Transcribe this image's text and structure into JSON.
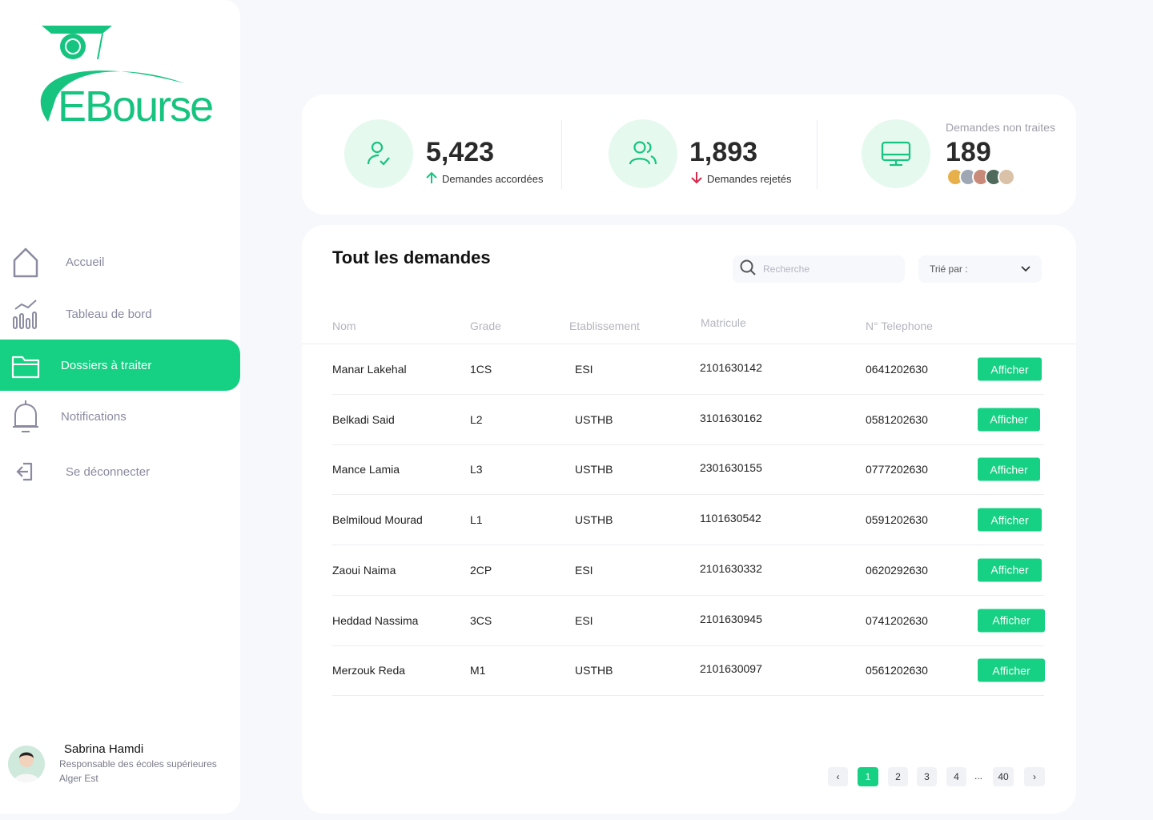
{
  "brand": {
    "name": "EBourse",
    "color": "#16d083"
  },
  "nav": [
    {
      "label": "Accueil",
      "icon": "home-icon"
    },
    {
      "label": "Tableau de bord",
      "icon": "chart-icon"
    },
    {
      "label": "Dossiers à traiter",
      "icon": "folder-icon",
      "active": true
    },
    {
      "label": "Notifications",
      "icon": "bell-icon"
    },
    {
      "label": "Se déconnecter",
      "icon": "logout-icon"
    }
  ],
  "profile": {
    "name": "Sabrina Hamdi",
    "role": "Responsable des écoles supérieures",
    "location": "Alger Est"
  },
  "stats": {
    "accepted": {
      "value": "5,423",
      "label": "Demandes accordées",
      "trend": "up"
    },
    "rejected": {
      "value": "1,893",
      "label": "Demandes rejetés",
      "trend": "down"
    },
    "pending": {
      "caption": "Demandes non traites",
      "value": "189"
    }
  },
  "table": {
    "title": "Tout les demandes",
    "search_placeholder": "Recherche",
    "sort_label": "Trié par :",
    "columns": [
      "Nom",
      "Grade",
      "Etablissement",
      "Matricule",
      "N° Telephone"
    ],
    "action_label": "Afficher",
    "rows": [
      {
        "nom": "Manar Lakehal",
        "grade": "1CS",
        "etab": "ESI",
        "matricule": "2101630142",
        "tel": "0641202630"
      },
      {
        "nom": "Belkadi Said",
        "grade": "L2",
        "etab": "USTHB",
        "matricule": "3101630162",
        "tel": "0581202630"
      },
      {
        "nom": "Mance Lamia",
        "grade": "L3",
        "etab": "USTHB",
        "matricule": "2301630155",
        "tel": "0777202630"
      },
      {
        "nom": "Belmiloud Mourad",
        "grade": "L1",
        "etab": "USTHB",
        "matricule": "1101630542",
        "tel": "0591202630"
      },
      {
        "nom": "Zaoui Naima",
        "grade": "2CP",
        "etab": "ESI",
        "matricule": "2101630332",
        "tel": "0620292630"
      },
      {
        "nom": "Heddad Nassima",
        "grade": "3CS",
        "etab": "ESI",
        "matricule": "2101630945",
        "tel": "0741202630"
      },
      {
        "nom": "Merzouk Reda",
        "grade": "M1",
        "etab": "USTHB",
        "matricule": "2101630097",
        "tel": "0561202630"
      }
    ]
  },
  "pagination": {
    "prev": "‹",
    "pages": [
      "1",
      "2",
      "3",
      "4"
    ],
    "ellipsis": "...",
    "last": "40",
    "next": "›",
    "current": "1"
  }
}
